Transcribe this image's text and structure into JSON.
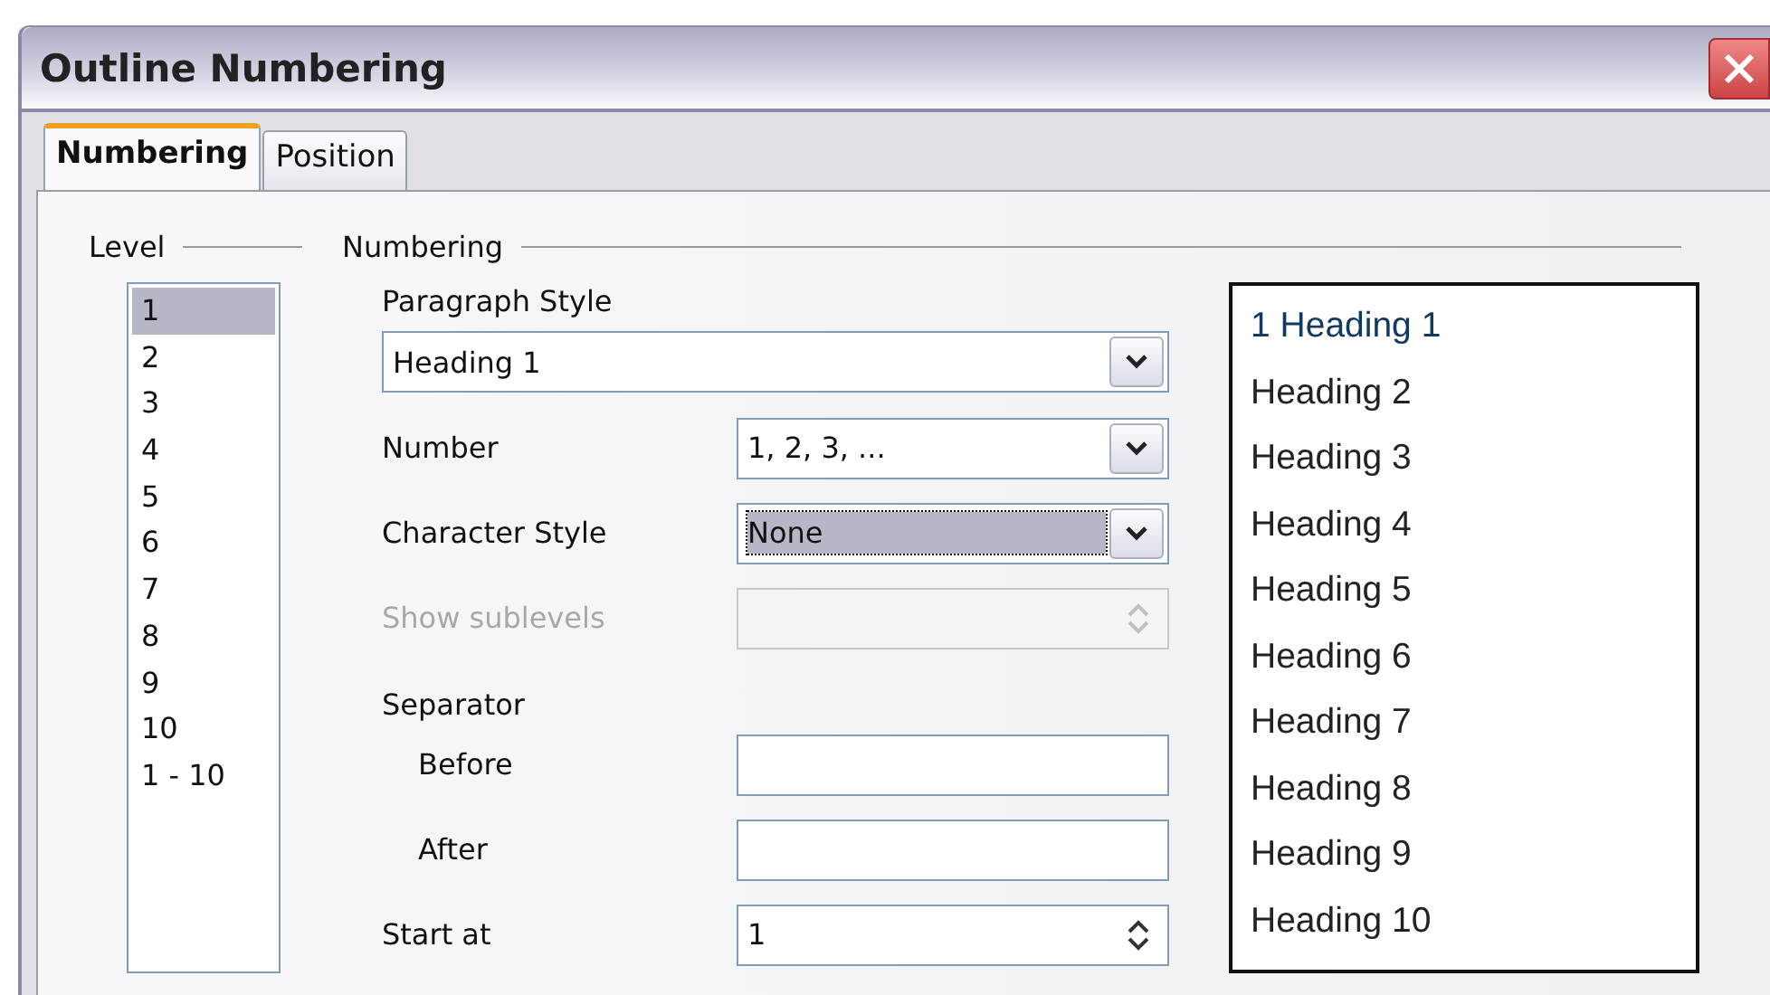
{
  "window": {
    "title": "Outline Numbering"
  },
  "tabs": [
    {
      "label": "Numbering",
      "selected": true
    },
    {
      "label": "Position",
      "selected": false
    }
  ],
  "level": {
    "legend": "Level",
    "items": [
      {
        "label": "1",
        "selected": true
      },
      {
        "label": "2",
        "selected": false
      },
      {
        "label": "3",
        "selected": false
      },
      {
        "label": "4",
        "selected": false
      },
      {
        "label": "5",
        "selected": false
      },
      {
        "label": "6",
        "selected": false
      },
      {
        "label": "7",
        "selected": false
      },
      {
        "label": "8",
        "selected": false
      },
      {
        "label": "9",
        "selected": false
      },
      {
        "label": "10",
        "selected": false
      },
      {
        "label": "1 - 10",
        "selected": false
      }
    ]
  },
  "numbering": {
    "legend": "Numbering",
    "fields": [
      {
        "kind": "wide-dropdown",
        "label": "Paragraph Style",
        "value": "Heading 1",
        "disabled": false
      },
      {
        "kind": "dropdown",
        "label": "Number",
        "value": "1, 2, 3, ...",
        "disabled": false
      },
      {
        "kind": "dropdown",
        "label": "Character Style",
        "value": "None",
        "disabled": false,
        "focused": true
      },
      {
        "kind": "spin",
        "label": "Show sublevels",
        "disabled": true
      },
      {
        "kind": "group",
        "label": "Separator",
        "children": [
          {
            "kind": "text",
            "label": "Before",
            "disabled": false
          },
          {
            "kind": "text",
            "label": "After",
            "disabled": false
          }
        ]
      },
      {
        "kind": "spin",
        "label": "Start at",
        "value": "1",
        "disabled": false
      }
    ]
  },
  "preview": {
    "lines": [
      "1 Heading 1",
      "Heading 2",
      "Heading 3",
      "Heading 4",
      "Heading 5",
      "Heading 6",
      "Heading 7",
      "Heading 8",
      "Heading 9",
      "Heading 10"
    ]
  }
}
